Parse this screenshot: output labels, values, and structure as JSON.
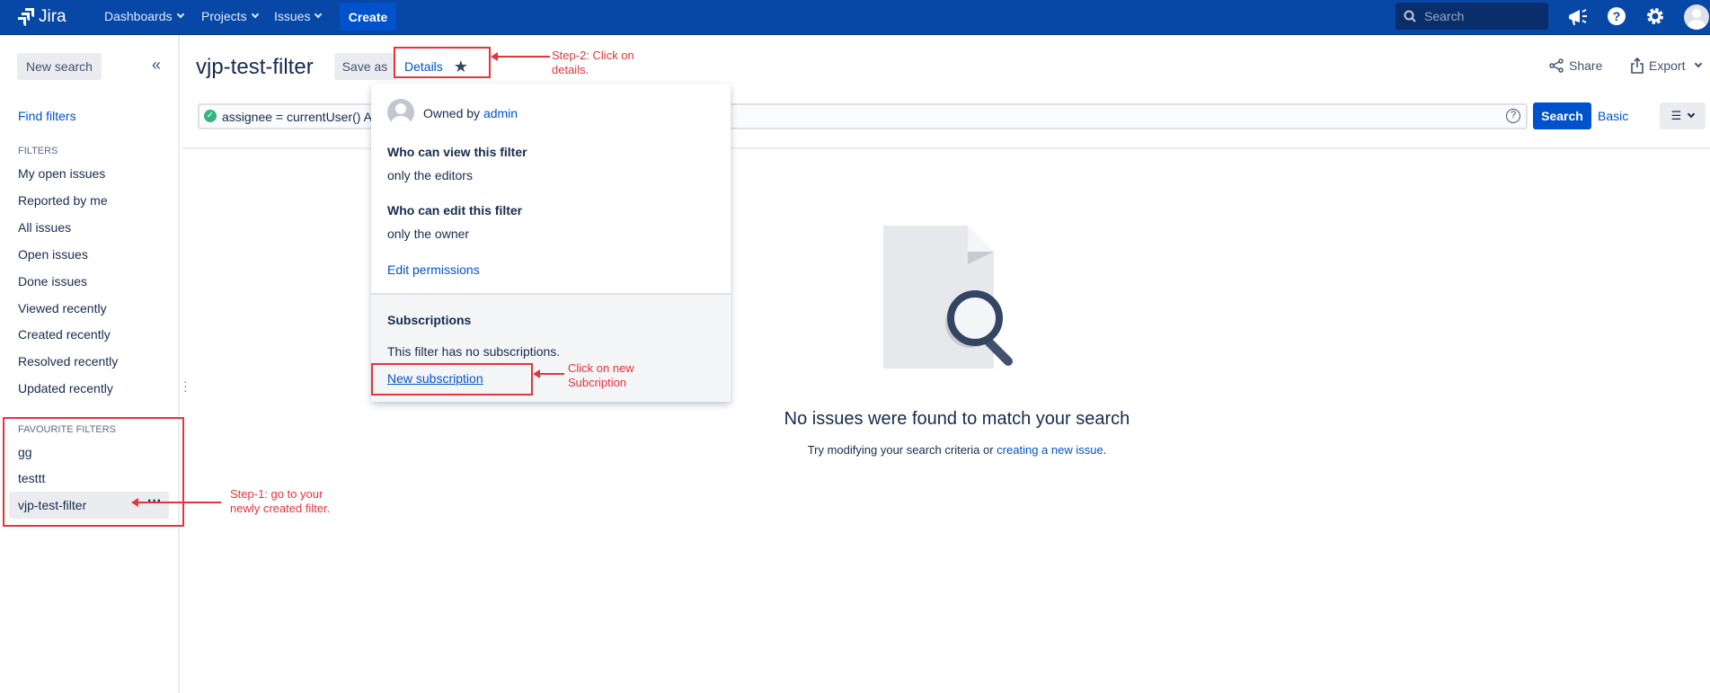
{
  "nav": {
    "logo": "Jira",
    "dashboards": "Dashboards",
    "projects": "Projects",
    "issues": "Issues",
    "create": "Create",
    "search_placeholder": "Search"
  },
  "sidebar": {
    "new_search": "New search",
    "find_filters": "Find filters",
    "filters_heading": "FILTERS",
    "filters": [
      "My open issues",
      "Reported by me",
      "All issues",
      "Open issues",
      "Done issues",
      "Viewed recently",
      "Created recently",
      "Resolved recently",
      "Updated recently"
    ],
    "favourites_heading": "FAVOURITE FILTERS",
    "favourites": [
      "gg",
      "testtt",
      "vjp-test-filter"
    ]
  },
  "header": {
    "title": "vjp-test-filter",
    "save_as": "Save as",
    "details": "Details",
    "share": "Share",
    "export": "Export"
  },
  "query": {
    "value": "assignee = currentUser() AI",
    "search": "Search",
    "basic": "Basic"
  },
  "popup": {
    "owned_by": "Owned by",
    "owner": "admin",
    "view_heading": "Who can view this filter",
    "view_value": "only the editors",
    "edit_heading": "Who can edit this filter",
    "edit_value": "only the owner",
    "edit_permissions": "Edit permissions",
    "subs_heading": "Subscriptions",
    "subs_empty": "This filter has no subscriptions.",
    "new_subscription": "New subscription"
  },
  "empty": {
    "title": "No issues were found to match your search",
    "text": "Try modifying your search criteria or",
    "link": "creating a new issue",
    "end": "."
  },
  "annotations": {
    "step1a": "Step-1: go to your",
    "step1b": "newly created filter.",
    "step2a": "Step-2: Click on",
    "step2b": "details.",
    "step3a": "Click on new",
    "step3b": "Subcription"
  },
  "colors": {
    "nav": "#0747a6",
    "primary": "#0052cc",
    "annotation": "#e5343a"
  }
}
